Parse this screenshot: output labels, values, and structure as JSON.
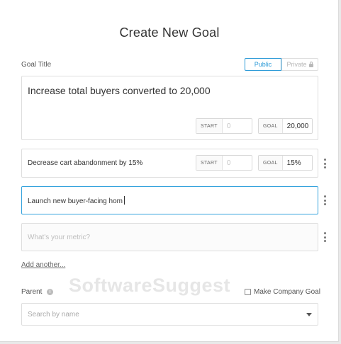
{
  "dialog": {
    "title": "Create New Goal"
  },
  "goal_title": {
    "label": "Goal Title",
    "visibility": {
      "public": "Public",
      "private": "Private",
      "selected": "Public"
    }
  },
  "goals": [
    {
      "text": "Increase total buyers converted to 20,000",
      "start_tag": "START",
      "start_value": "0",
      "goal_tag": "GOAL",
      "goal_value": "20,000"
    },
    {
      "text": "Decrease cart abandonment by 15%",
      "start_tag": "START",
      "start_value": "0",
      "goal_tag": "GOAL",
      "goal_value": "15%"
    },
    {
      "text": "Launch new buyer-facing hom"
    },
    {
      "placeholder": "What's your metric?"
    }
  ],
  "add_another": "Add another...",
  "parent": {
    "label": "Parent",
    "make_company_goal": "Make Company Goal",
    "search_placeholder": "Search by name"
  },
  "watermark": "SoftwareSuggest",
  "colors": {
    "accent": "#2b9ad7",
    "focus_border": "#36a3dd"
  }
}
